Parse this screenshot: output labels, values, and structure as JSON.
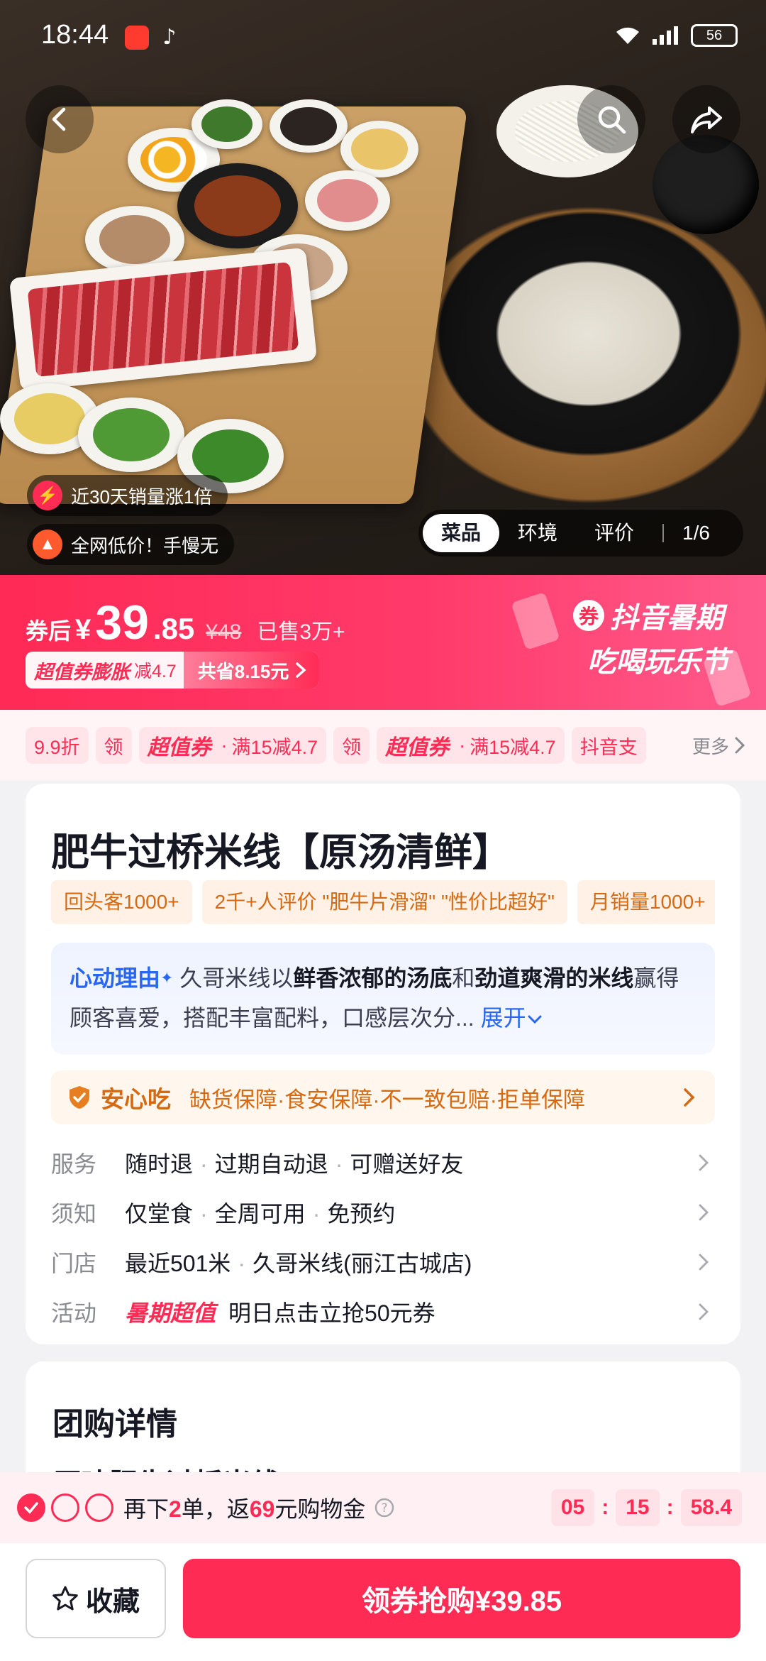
{
  "status": {
    "time": "18:44",
    "battery": "56"
  },
  "hero": {
    "badge1": "近30天销量涨1倍",
    "badge2": "全网低价！手慢无",
    "tabs": [
      "菜品",
      "环境",
      "评价"
    ],
    "counter": "1/6"
  },
  "price": {
    "label": "券后",
    "yen": "¥",
    "int": "39",
    "dec": ".85",
    "original": "¥48",
    "sold": "已售3万+",
    "coupon_tag": "超值券膨胀",
    "coupon_minus": "减4.7",
    "coupon_save": "共省8.15元",
    "festival_line1": "抖音暑期",
    "festival_line2": "吃喝玩乐节",
    "festival_ticket": "券"
  },
  "coupons": {
    "c1": "9.9折",
    "c1_get": "领",
    "c2_tag": "超值券",
    "c2_text": "满15减4.7",
    "c2_get": "领",
    "c3_tag": "超值券",
    "c3_text": "满15减4.7",
    "c4": "抖音支",
    "more": "更多"
  },
  "product": {
    "title": "肥牛过桥米线【原汤清鲜】",
    "tags": [
      "回头客1000+",
      "2千+人评价 \"肥牛片滑溜\" \"性价比超好\"",
      "月销量1000+"
    ],
    "reason_head": "心动理由",
    "reason_a": "久哥米线以",
    "reason_b": "鲜香浓郁的汤底",
    "reason_c": "和",
    "reason_d": "劲道爽滑的米线",
    "reason_e": "赢得顾客喜爱，搭配丰富配料，口感层次分...",
    "reason_more": "展开",
    "safe_title": "安心吃",
    "safe_items": "缺货保障·食安保障·不一致包赔·拒单保障"
  },
  "info": {
    "service_k": "服务",
    "service_1": "随时退",
    "service_2": "过期自动退",
    "service_3": "可赠送好友",
    "notice_k": "须知",
    "notice_1": "仅堂食",
    "notice_2": "全周可用",
    "notice_3": "免预约",
    "store_k": "门店",
    "store_1": "最近501米",
    "store_2": "久哥米线(丽江古城店)",
    "activity_k": "活动",
    "activity_hot": "暑期超值",
    "activity_text": "明日点击立抢50元券"
  },
  "detail": {
    "title": "团购详情",
    "peek": "原味肥牛过桥米线"
  },
  "promo": {
    "t1": "再下",
    "n1": "2",
    "t2": "单，返",
    "n2": "69",
    "t3": "元购物金",
    "h": "05",
    "m": "15",
    "s": "58.4"
  },
  "bottom": {
    "fav": "收藏",
    "buy": "领券抢购¥39.85"
  },
  "colors": {
    "brand": "#fe2c55",
    "link": "#2867f2",
    "warn": "#d56a12"
  }
}
